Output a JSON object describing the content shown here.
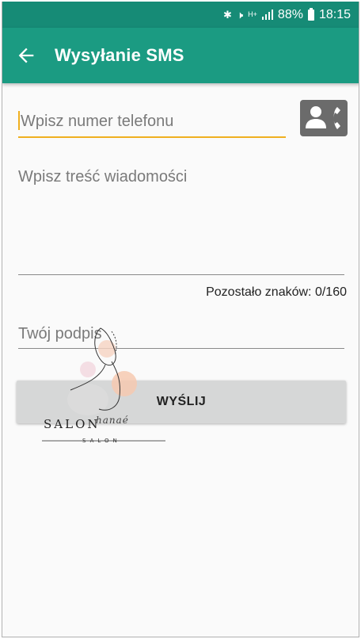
{
  "status_bar": {
    "network_type": "H+",
    "battery_percent": "88%",
    "time": "18:15"
  },
  "toolbar": {
    "title": "Wysyłanie SMS"
  },
  "form": {
    "phone_placeholder": "Wpisz numer telefonu",
    "phone_value": "",
    "message_placeholder": "Wpisz treść wiadomości",
    "message_value": "",
    "counter_label": "Pozostało znaków:",
    "counter_value": "0/160",
    "signature_placeholder": "Twój podpis",
    "signature_value": "",
    "send_label": "WYŚLIJ"
  },
  "watermark": {
    "line1": "SALON",
    "line2": "hanaé",
    "line3": "SALON"
  },
  "colors": {
    "status_bar": "#168b76",
    "toolbar": "#1b9b82",
    "accent": "#f0b020",
    "button": "#d6d7d7"
  }
}
